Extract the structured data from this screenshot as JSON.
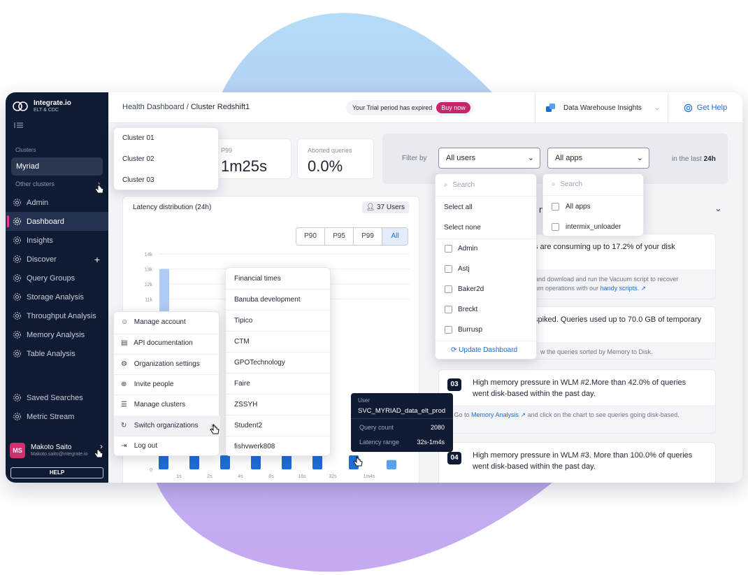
{
  "app": {
    "name": "Integrate.io",
    "subtitle": "ELT & CDC"
  },
  "sidebar": {
    "section_label": "Clusters",
    "current_cluster": "Myriad",
    "other_clusters_label": "Other clusters",
    "items": [
      {
        "label": "Admin",
        "icon": "gear-icon"
      },
      {
        "label": "Dashboard",
        "icon": "gear-icon",
        "active": true
      },
      {
        "label": "Insights",
        "icon": "gear-icon"
      },
      {
        "label": "Discover",
        "icon": "gear-icon"
      },
      {
        "label": "Query Groups",
        "icon": "gear-icon"
      },
      {
        "label": "Storage Analysis",
        "icon": "gear-icon"
      },
      {
        "label": "Throughput Analysis",
        "icon": "gear-icon"
      },
      {
        "label": "Memory Analysis",
        "icon": "gear-icon"
      },
      {
        "label": "Table Analysis",
        "icon": "gear-icon"
      },
      {
        "label": "Saved Searches",
        "icon": "gear-icon"
      },
      {
        "label": "Metric Stream",
        "icon": "gear-icon"
      }
    ],
    "user": {
      "initials": "MS",
      "name": "Makoto Saito",
      "email": "Makoto.saito@integrate.io"
    },
    "help_label": "HELP"
  },
  "header": {
    "breadcrumb": [
      "Health Dashboard",
      "Cluster Redshift1"
    ],
    "breadcrumb_sep": "/",
    "trial_text": "Your Trial period has expired",
    "buy_label": "Buy now",
    "product": "Data Warehouse Insights",
    "get_help": "Get Help"
  },
  "stats": {
    "p99_label": "P99",
    "p99_value": "1m25s",
    "aborted_label": "Aborted queries",
    "aborted_value": "0.0%"
  },
  "filters": {
    "filter_by": "Filter by",
    "users_value": "All users",
    "apps_value": "All apps",
    "last_label": "in the last",
    "last_value": "24h",
    "users_search_placeholder": "Search",
    "apps_search_placeholder": "Search",
    "select_all": "Select all",
    "select_none": "Select none",
    "user_options": [
      "Admin",
      "Astj",
      "Baker2d",
      "Breckt",
      "Burrusp"
    ],
    "update_label": "Update Dashboard",
    "app_options": [
      "All apps",
      "intermix_unloader"
    ]
  },
  "cluster_menu": [
    "Cluster 01",
    "Cluster 02",
    "Cluster 03"
  ],
  "account_menu": [
    {
      "label": "Manage account",
      "icon": "user-gear-icon"
    },
    {
      "label": "API documentation",
      "icon": "document-icon"
    },
    {
      "label": "Organization settings",
      "icon": "settings-icon"
    },
    {
      "label": "Invite people",
      "icon": "user-plus-icon"
    },
    {
      "label": "Manage clusters",
      "icon": "layers-icon"
    },
    {
      "label": "Switch organizations",
      "icon": "switch-icon"
    },
    {
      "label": "Log out",
      "icon": "logout-icon"
    }
  ],
  "org_menu": [
    "Financial times",
    "Banuba development",
    "Tipico",
    "CTM",
    "GPOTechnology",
    "Faire",
    "ZSSYH",
    "Student2",
    "fishvwerk808"
  ],
  "chart": {
    "title": "Latency distribution (24h)",
    "users_badge": "37 Users",
    "percentile_buttons": [
      "P90",
      "P95",
      "P99",
      "All"
    ],
    "selected_button": "All"
  },
  "chart_data": {
    "type": "bar",
    "title": "Latency distribution (24h)",
    "categories": [
      "1s",
      "2s",
      "4s",
      "8s",
      "16s",
      "32s",
      "1m4s",
      ""
    ],
    "y_ticks": [
      "14k",
      "13k",
      "12k",
      "11k",
      "0"
    ],
    "visible_bar_bottoms": [
      1200,
      1200,
      1200,
      1200,
      1200,
      1200,
      1200,
      800
    ],
    "highlighted_bar_top": 13000,
    "series": [
      {
        "values": [
          13000,
          1200,
          1200,
          1200,
          1200,
          1200,
          1200,
          800
        ]
      }
    ],
    "ylim": [
      0,
      14000
    ],
    "grid": true
  },
  "tooltip": {
    "title": "User",
    "user": "SVC_MYRIAD_data_elt_prod",
    "rows": [
      {
        "label": "Query count",
        "value": "2080"
      },
      {
        "label": "Latency range",
        "value": "32s-1m4s"
      }
    ]
  },
  "insights": {
    "header_fragment": "n",
    "cards": [
      {
        "title": "s are consuming up to 17.2% of your disk",
        "footer": "and download and run the Vacuum script to recover",
        "footer2": "um operations with our",
        "link": "handy scripts."
      },
      {
        "title": "spiked. Queries used up to 70.0 GB of temporary",
        "footer": "w the queries sorted by Memory to Disk."
      },
      {
        "num": "03",
        "title": "High memory pressure in WLM #2.More than 42.0% of queries went disk-based within the past day.",
        "footer_pre": "→ Go to",
        "link": "Memory Analysis",
        "footer_post": "and click on the chart to see queries going disk-based."
      },
      {
        "num": "04",
        "title": "High memory pressure in WLM #3. More than 100.0% of queries went disk-based within the past day."
      }
    ]
  },
  "colors": {
    "sidebar": "#0f1b33",
    "accent": "#1e6cd6",
    "pink": "#c7256b",
    "blob": "#b7b5f4"
  }
}
